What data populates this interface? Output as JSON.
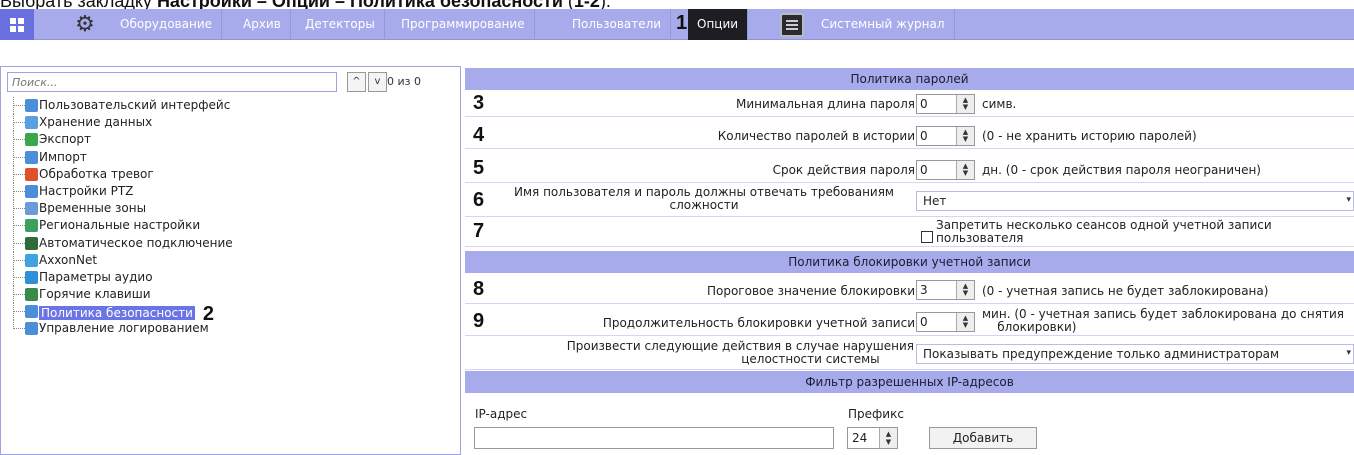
{
  "caption": {
    "prefix": "Выбрать закладку ",
    "bold": "Настройки – Опции – Политика безопасности",
    "suffix_open": " (",
    "suffix_bold": "1-2",
    "suffix_close": ")."
  },
  "toolbar": {
    "tabs": [
      "Оборудование",
      "Архив",
      "Детекторы",
      "Программирование",
      "Пользователи",
      "Опции",
      "Системный журнал"
    ],
    "active_tab": "Опции",
    "marker": "1"
  },
  "left": {
    "search_placeholder": "Поиск...",
    "up_arrow": "^",
    "down_arrow": "v",
    "count": "0 из 0",
    "tree": [
      {
        "label": "Пользовательский интерфейс",
        "icon": "monitor-icon",
        "color": "#4a8fd8"
      },
      {
        "label": "Хранение данных",
        "icon": "storage-icon",
        "color": "#5aa0e0"
      },
      {
        "label": "Экспорт",
        "icon": "export-icon",
        "color": "#38a84a"
      },
      {
        "label": "Импорт",
        "icon": "import-icon",
        "color": "#4a8fd8"
      },
      {
        "label": "Обработка тревог",
        "icon": "alarm-icon",
        "color": "#e0502a"
      },
      {
        "label": "Настройки PTZ",
        "icon": "ptz-icon",
        "color": "#4a8fd8"
      },
      {
        "label": "Временные зоны",
        "icon": "clock-icon",
        "color": "#6b9ad8"
      },
      {
        "label": "Региональные настройки",
        "icon": "globe-icon",
        "color": "#3aa060"
      },
      {
        "label": "Автоматическое подключение",
        "icon": "plug-icon",
        "color": "#2f6b3a"
      },
      {
        "label": "AxxonNet",
        "icon": "cloud-icon",
        "color": "#3fa3e0"
      },
      {
        "label": "Параметры аудио",
        "icon": "audio-icon",
        "color": "#2f8fd8"
      },
      {
        "label": "Горячие клавиши",
        "icon": "keyboard-icon",
        "color": "#3a8a4a"
      },
      {
        "label": "Политика безопасности",
        "icon": "security-icon",
        "color": "#4a8fd8",
        "selected": true,
        "marker": "2"
      },
      {
        "label": "Управление логированием",
        "icon": "log-icon",
        "color": "#4a8fd8"
      }
    ]
  },
  "right": {
    "password_policy_header": "Политика паролей",
    "min_length": {
      "num": "3",
      "label": "Минимальная длина пароля",
      "value": "0",
      "hint": "симв."
    },
    "history": {
      "num": "4",
      "label": "Количество паролей в истории",
      "value": "0",
      "hint": "(0 - не хранить историю паролей)"
    },
    "expiry": {
      "num": "5",
      "label": "Срок действия пароля",
      "value": "0",
      "hint": "дн. (0 - срок действия пароля неограничен)"
    },
    "complexity": {
      "num": "6",
      "label_line1": "Имя пользователя и пароль должны отвечать требованиям",
      "label_line2": "сложности",
      "value": "Нет"
    },
    "sessions": {
      "num": "7",
      "hint_line1": "Запретить несколько сеансов одной учетной записи",
      "hint_line2": "пользователя",
      "checked": false
    },
    "lockout_header": "Политика блокировки учетной записи",
    "threshold": {
      "num": "8",
      "label": "Пороговое значение блокировки",
      "value": "3",
      "hint": "(0 - учетная запись не будет заблокирована)"
    },
    "duration": {
      "num": "9",
      "label": "Продолжительность блокировки учетной записи",
      "value": "0",
      "hint_line1": "мин. (0 - учетная запись будет заблокирована до снятия",
      "hint_line2": "блокировки)"
    },
    "integrity": {
      "label_line1": "Произвести следующие действия в случае нарушения",
      "label_line2": "целостности системы",
      "value": "Показывать предупреждение только администраторам"
    },
    "ip_filter_header": "Фильтр разрешенных IP-адресов",
    "ip_label": "IP-адрес",
    "prefix_label": "Префикс",
    "ip_value": "",
    "prefix_value": "24",
    "add_button": "Добавить"
  }
}
